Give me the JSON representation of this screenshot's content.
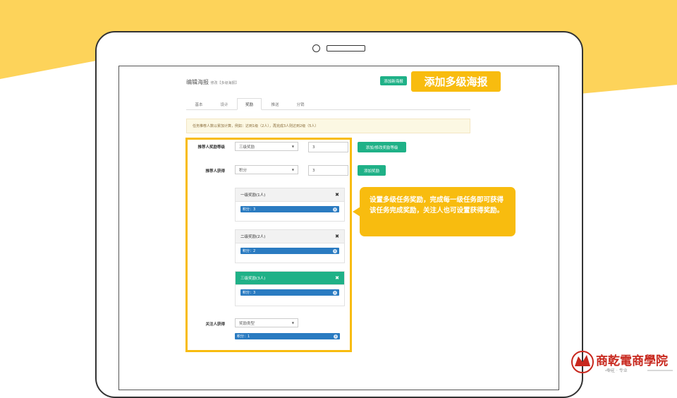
{
  "colors": {
    "accent_yellow": "#f8bc0f",
    "teal": "#1fb187",
    "pill_blue": "#2a7bc1",
    "brand_red": "#c8281e"
  },
  "page": {
    "title": "编辑海报",
    "title_sub": "修改【多级海报】",
    "add_poster_button": "添加新海报"
  },
  "callout": {
    "title": "添加多级海报",
    "description": "设置多级任务奖励，完成每一级任务即可获得该任务完成奖励，关注人也可设置获得奖励。"
  },
  "tabs": [
    {
      "label": "基本"
    },
    {
      "label": "设计"
    },
    {
      "label": "奖励"
    },
    {
      "label": "推送"
    },
    {
      "label": "分销"
    }
  ],
  "notice": "任务推荐人数以累加计算，例如：达到1级（2人），再完成3人则达到2级（5人）",
  "reward_level": {
    "label": "推荐人奖励等级",
    "select_value": "三级奖励",
    "input_value": "3",
    "button": "添加/修改奖励等级"
  },
  "referrer_gets": {
    "label": "推荐人获得",
    "select_value": "积分",
    "input_value": "3",
    "button": "添加奖励"
  },
  "levels": [
    {
      "title": "一级奖励(1人)",
      "pill": "积分：3"
    },
    {
      "title": "二级奖励(2人)",
      "pill": "积分：2"
    },
    {
      "title": "三级奖励(3人)",
      "pill": "积分：3"
    }
  ],
  "follower_gets": {
    "label": "关注人获得",
    "select_placeholder": "奖励类型",
    "pill": "积分：1"
  },
  "logo": {
    "name": "商乾電商學院",
    "tagline": "专注 · 专业"
  }
}
